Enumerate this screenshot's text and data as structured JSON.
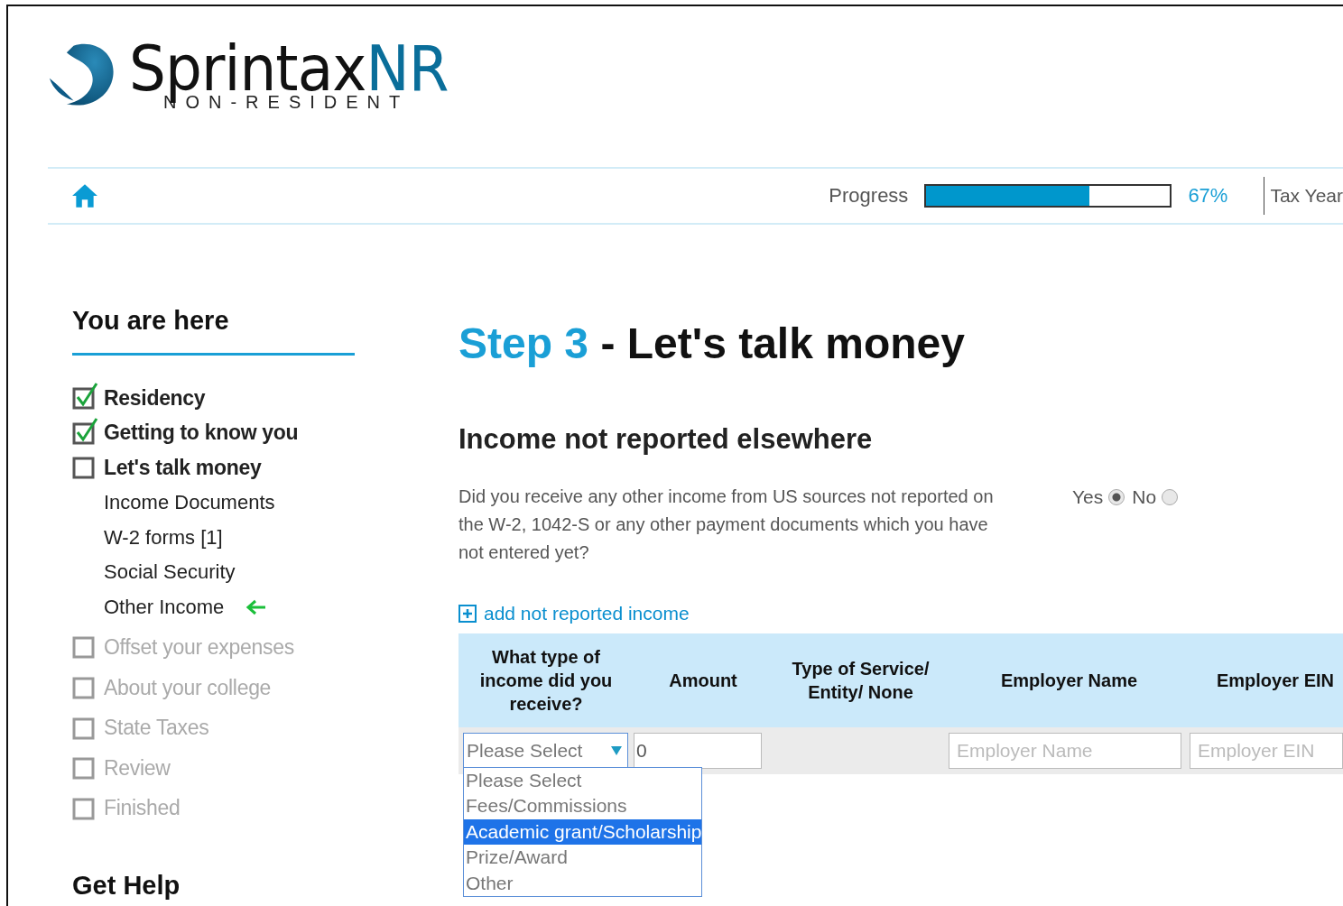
{
  "logo": {
    "name": "Sprintax",
    "suffix": "NR",
    "tagline": "NON-RESIDENT"
  },
  "progress": {
    "label": "Progress",
    "level": 0.67,
    "reading": "67%",
    "tax_year": "Tax Year"
  },
  "sidebar": {
    "title": "You are here",
    "items": [
      {
        "kind": "step",
        "label": "Residency",
        "checked": true,
        "disabled": false
      },
      {
        "kind": "step",
        "label": "Getting to know you",
        "checked": true,
        "disabled": false
      },
      {
        "kind": "step",
        "label": "Let's talk money",
        "checked": false,
        "disabled": false
      },
      {
        "kind": "sub",
        "label": "Income Documents",
        "current": false
      },
      {
        "kind": "sub",
        "label": "W-2 forms [1]",
        "current": false
      },
      {
        "kind": "sub",
        "label": "Social Security",
        "current": false
      },
      {
        "kind": "sub",
        "label": "Other Income",
        "current": true
      },
      {
        "kind": "step",
        "label": "Offset your expenses",
        "checked": false,
        "disabled": true
      },
      {
        "kind": "step",
        "label": "About your college",
        "checked": false,
        "disabled": true
      },
      {
        "kind": "step",
        "label": "State Taxes",
        "checked": false,
        "disabled": true
      },
      {
        "kind": "step",
        "label": "Review",
        "checked": false,
        "disabled": true
      },
      {
        "kind": "step",
        "label": "Finished",
        "checked": false,
        "disabled": true
      }
    ],
    "help_title": "Get Help"
  },
  "main": {
    "step": "Step 3",
    "separator": "-",
    "title": "Let's talk money",
    "section": "Income not reported elsewhere",
    "question": "Did you receive any other income from US sources not reported on the W-2, 1042-S or any other payment documents which you have not entered yet?",
    "answers": [
      {
        "label": "Yes",
        "selected": true
      },
      {
        "label": "No",
        "selected": false
      }
    ],
    "add_link": "add not reported income",
    "table": {
      "columns": [
        "What type of income did you receive?",
        "Amount",
        "Type of Service/ Entity/ None",
        "Employer Name",
        "Employer EIN"
      ],
      "row": {
        "type": "Please Select",
        "amount": "0",
        "employer_name_placeholder": "Employer Name",
        "employer_ein_placeholder": "Employer EIN"
      },
      "options": [
        {
          "label": "Please Select",
          "selected": false
        },
        {
          "label": "Fees/Commissions",
          "selected": false
        },
        {
          "label": "Academic grant/Scholarship",
          "selected": true
        },
        {
          "label": "Prize/Award",
          "selected": false
        },
        {
          "label": "Other",
          "selected": false
        }
      ]
    }
  }
}
